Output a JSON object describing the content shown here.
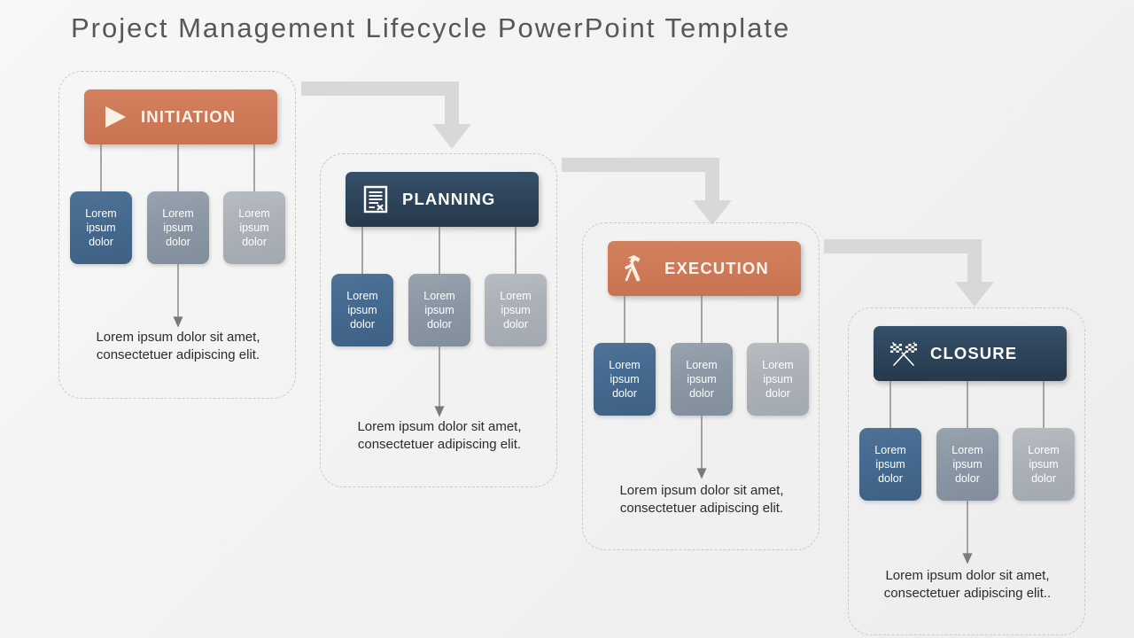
{
  "page": {
    "title": "Project Management Lifecycle PowerPoint Template",
    "background_color": "#f2f2f2"
  },
  "colors": {
    "orange": "#cd7957",
    "navy": "#2c4358",
    "box_dark_blue": "#456a8f",
    "box_mid_grey": "#8b97a4",
    "box_light_grey": "#abb1b7",
    "connector_grey": "#d6d6d6",
    "thin_arrow_grey": "#7a7a7a",
    "dashed_border": "#c9c9c9",
    "title_text": "#575757",
    "caption_text": "#2b2b2b"
  },
  "sub_box_labels": {
    "line1": "Lorem",
    "line2": "ipsum",
    "line3": "dolor"
  },
  "stages": [
    {
      "id": "initiation",
      "label": "INITIATION",
      "icon": "play-triangle-icon",
      "theme": "orange",
      "boxes": [
        {
          "line1": "Lorem",
          "line2": "ipsum",
          "line3": "dolor"
        },
        {
          "line1": "Lorem",
          "line2": "ipsum",
          "line3": "dolor"
        },
        {
          "line1": "Lorem",
          "line2": "ipsum",
          "line3": "dolor"
        }
      ],
      "caption": "Lorem ipsum dolor sit amet, consectetuer adipiscing elit."
    },
    {
      "id": "planning",
      "label": "PLANNING",
      "icon": "document-checklist-icon",
      "theme": "navy",
      "boxes": [
        {
          "line1": "Lorem",
          "line2": "ipsum",
          "line3": "dolor"
        },
        {
          "line1": "Lorem",
          "line2": "ipsum",
          "line3": "dolor"
        },
        {
          "line1": "Lorem",
          "line2": "ipsum",
          "line3": "dolor"
        }
      ],
      "caption": "Lorem ipsum dolor sit amet, consectetuer adipiscing elit."
    },
    {
      "id": "execution",
      "label": "EXECUTION",
      "icon": "hammer-tools-icon",
      "theme": "orange",
      "boxes": [
        {
          "line1": "Lorem",
          "line2": "ipsum",
          "line3": "dolor"
        },
        {
          "line1": "Lorem",
          "line2": "ipsum",
          "line3": "dolor"
        },
        {
          "line1": "Lorem",
          "line2": "ipsum",
          "line3": "dolor"
        }
      ],
      "caption": "Lorem ipsum dolor sit amet, consectetuer adipiscing elit."
    },
    {
      "id": "closure",
      "label": "CLOSURE",
      "icon": "checkered-flags-icon",
      "theme": "navy",
      "boxes": [
        {
          "line1": "Lorem",
          "line2": "ipsum",
          "line3": "dolor"
        },
        {
          "line1": "Lorem",
          "line2": "ipsum",
          "line3": "dolor"
        },
        {
          "line1": "Lorem",
          "line2": "ipsum",
          "line3": "dolor"
        }
      ],
      "caption": "Lorem ipsum dolor sit amet, consectetuer adipiscing elit.."
    }
  ]
}
